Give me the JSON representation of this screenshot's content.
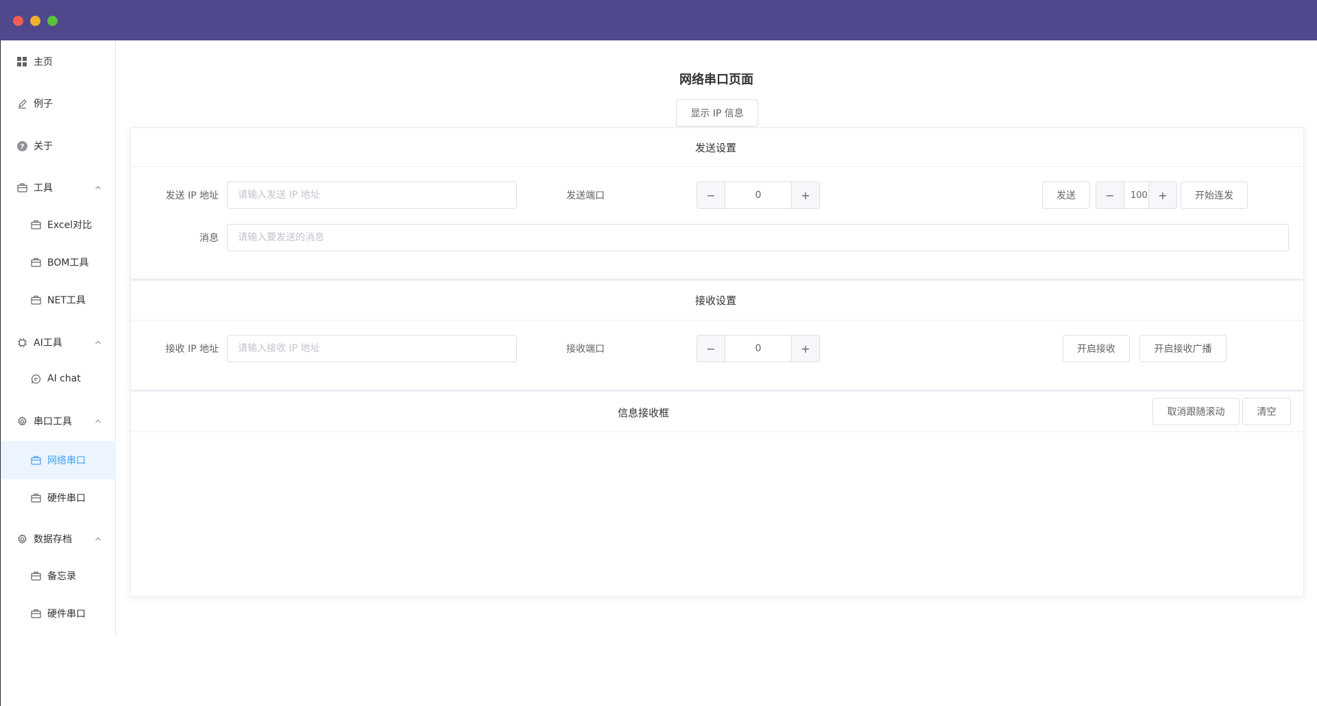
{
  "window": {
    "controls": [
      "close",
      "minimize",
      "maximize"
    ]
  },
  "sidebar": {
    "items": [
      {
        "label": "主页",
        "icon": "grid-icon"
      },
      {
        "label": "例子",
        "icon": "edit-icon"
      },
      {
        "label": "关于",
        "icon": "question-circle-icon"
      },
      {
        "label": "工具",
        "icon": "briefcase-icon",
        "expanded": true
      },
      {
        "label": "Excel对比",
        "icon": "briefcase-icon"
      },
      {
        "label": "BOM工具",
        "icon": "briefcase-icon"
      },
      {
        "label": "NET工具",
        "icon": "briefcase-icon"
      },
      {
        "label": "AI工具",
        "icon": "cpu-icon",
        "expanded": true
      },
      {
        "label": "AI chat",
        "icon": "chat-icon"
      },
      {
        "label": "串口工具",
        "icon": "gear-icon",
        "expanded": true
      },
      {
        "label": "网络串口",
        "icon": "briefcase-icon",
        "active": true
      },
      {
        "label": "硬件串口",
        "icon": "briefcase-icon"
      },
      {
        "label": "数据存档",
        "icon": "gear-icon",
        "expanded": true
      },
      {
        "label": "备忘录",
        "icon": "briefcase-icon"
      },
      {
        "label": "硬件串口",
        "icon": "briefcase-icon"
      }
    ]
  },
  "main": {
    "title": "网络串口页面",
    "show_ip_button": "显示 IP 信息",
    "send": {
      "title": "发送设置",
      "ip_label": "发送 IP 地址",
      "ip_placeholder": "请输入发送 IP 地址",
      "port_label": "发送端口",
      "port_value": "0",
      "send_button": "发送",
      "interval_value": "100",
      "continuous_button": "开始连发",
      "message_label": "消息",
      "message_placeholder": "请输入要发送的消息"
    },
    "receive": {
      "title": "接收设置",
      "ip_label": "接收 IP 地址",
      "ip_placeholder": "请输入接收 IP 地址",
      "port_label": "接收端口",
      "port_value": "0",
      "start_button": "开启接收",
      "broadcast_button": "开启接收广播"
    },
    "messages": {
      "title": "信息接收框",
      "cancel_scroll_button": "取消跟随滚动",
      "clear_button": "清空"
    }
  },
  "colors": {
    "titlebar": "#4f488c",
    "accent": "#409eff",
    "active_bg": "#ecf5ff"
  }
}
